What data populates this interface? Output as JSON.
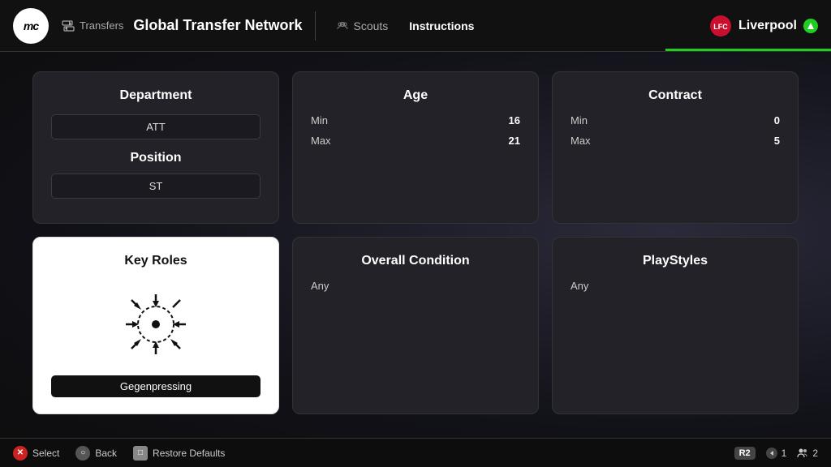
{
  "logo": {
    "text": "mc"
  },
  "nav": {
    "transfers_label": "Transfers",
    "main_title": "Global Transfer Network",
    "tabs": [
      {
        "id": "scouts",
        "label": "Scouts",
        "active": false
      },
      {
        "id": "instructions",
        "label": "Instructions",
        "active": true
      }
    ]
  },
  "club": {
    "name": "Liverpool",
    "status": "active"
  },
  "cards": {
    "department": {
      "title": "Department",
      "value": "ATT"
    },
    "position": {
      "title": "Position",
      "value": "ST"
    },
    "age": {
      "title": "Age",
      "min_label": "Min",
      "min_value": "16",
      "max_label": "Max",
      "max_value": "21"
    },
    "contract": {
      "title": "Contract",
      "min_label": "Min",
      "min_value": "0",
      "max_label": "Max",
      "max_value": "5"
    },
    "key_roles": {
      "title": "Key Roles",
      "tactic": "Gegenpressing"
    },
    "overall_condition": {
      "title": "Overall Condition",
      "value": "Any"
    },
    "playstyles": {
      "title": "PlayStyles",
      "value": "Any"
    }
  },
  "bottombar": {
    "select_label": "Select",
    "back_label": "Back",
    "restore_label": "Restore Defaults"
  },
  "bottom_right": {
    "r2": "R2",
    "count1": "1",
    "count2": "2"
  }
}
